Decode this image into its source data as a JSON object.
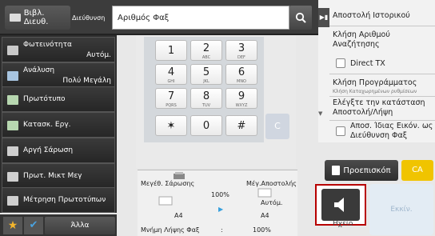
{
  "header": {
    "address_book": "Βιβλ. Διευθ.",
    "destination_label": "Διεύθυνση",
    "fax_number_value": "Αριθμός Φαξ"
  },
  "sidebar": {
    "items": [
      {
        "label": "Φωτεινότητα",
        "value": "Αυτόμ."
      },
      {
        "label": "Ανάλυση",
        "value": "Πολύ Μεγάλη"
      },
      {
        "label": "Πρωτότυπο",
        "value": ""
      },
      {
        "label": "Κατασκ. Εργ.",
        "value": ""
      },
      {
        "label": "Αργή Σάρωση",
        "value": ""
      },
      {
        "label": "Πρωτ. Μικτ Μεγ",
        "value": ""
      },
      {
        "label": "Μέτρηση Πρωτοτύπων",
        "value": ""
      }
    ]
  },
  "bottom_bar": {
    "other_label": "Άλλα"
  },
  "keypad": {
    "keys": [
      {
        "num": "1",
        "sub": ""
      },
      {
        "num": "2",
        "sub": "ABC"
      },
      {
        "num": "3",
        "sub": "DEF"
      },
      {
        "num": "4",
        "sub": "GHI"
      },
      {
        "num": "5",
        "sub": "JKL"
      },
      {
        "num": "6",
        "sub": "MNO"
      },
      {
        "num": "7",
        "sub": "PQRS"
      },
      {
        "num": "8",
        "sub": "TUV"
      },
      {
        "num": "9",
        "sub": "WXYZ"
      },
      {
        "num": "✶",
        "sub": ""
      },
      {
        "num": "0",
        "sub": ""
      },
      {
        "num": "#",
        "sub": ""
      }
    ],
    "clear_label": "C"
  },
  "scan_info": {
    "scan_size_label": "Μεγέθ. Σάρωσης",
    "send_size_label": "Μέγ.Αποστολής",
    "ratio": "100%",
    "send_mode": "Αυτόμ.",
    "scan_paper": "A4",
    "send_paper": "A4",
    "fax_memory_label": "Μνήμη Λήψης Φαξ",
    "fax_memory_sep": ":",
    "fax_memory_value": "100%"
  },
  "right_panel": {
    "send_history": "Αποστολή Ιστορικού",
    "call_number_search": "Κλήση Αριθμού Αναζήτησης",
    "direct_tx": "Direct TX",
    "program_call": "Κλήση Προγράμματος",
    "program_call_sub": "Κλήση Καταχωρημένων ρυθμίσεων",
    "check_status": "Ελέγξτε την κατάσταση Αποστολή/Λήψη",
    "same_image": "Αποσ. Ίδιας Εικόν. ως Διεύθυνση Φαξ"
  },
  "actions": {
    "preview": "Προεπισκόπ",
    "ca": "CA",
    "file": "Ηχείο",
    "start": "Εκκίν."
  },
  "colors": {
    "highlight_border": "#b70000",
    "ca_yellow": "#f0c400"
  }
}
